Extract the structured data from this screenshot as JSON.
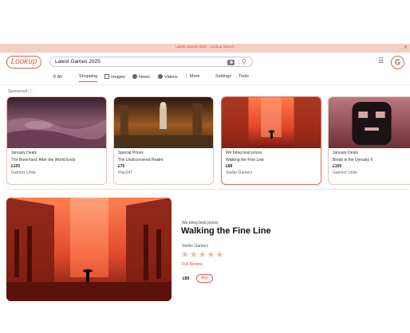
{
  "window": {
    "title": "Latest Games 2025 - Lookup Search",
    "new_tab_icon": "plus-icon"
  },
  "header": {
    "logo": "Lookup",
    "search_query": "Latest Games 2025",
    "avatar_letter": "G",
    "icons": [
      "camera-icon",
      "search-icon",
      "apps-grid-icon"
    ]
  },
  "tabs": [
    {
      "label": "All",
      "icon": "search-icon"
    },
    {
      "label": "Shopping",
      "active": true
    },
    {
      "label": "Images",
      "icon": "image-icon"
    },
    {
      "label": "News",
      "icon": "news-icon"
    },
    {
      "label": "Videos",
      "icon": "video-icon"
    },
    {
      "label": "More",
      "icon": "more-icon"
    },
    {
      "label": "Settings"
    },
    {
      "label": "Tools"
    }
  ],
  "sponsored": {
    "label": "Sponsored",
    "icon": "info-icon"
  },
  "products": [
    {
      "deal": "January Deals",
      "name": "The BoneYard: After the World Ends",
      "price": "£105",
      "seller": "Gamerz Unite"
    },
    {
      "deal": "Special Prices",
      "name": "The Undiscovered Realm",
      "price": "£75",
      "seller": "Play247"
    },
    {
      "deal": "We bring best prices",
      "name": "Walking the Fine Line",
      "price": "£89",
      "seller": "Steller Gamerz",
      "selected": true
    },
    {
      "deal": "January Deals",
      "name": "Break in the Dynasty II",
      "price": "£100",
      "seller": "Gamerz Unite"
    }
  ],
  "featured": {
    "deal": "We bring best prices",
    "title": "Walking the Fine Line",
    "seller": "Steller Gamerz",
    "rating_stars": "★★★★★",
    "rating": 0,
    "review_link": "Full Review",
    "price": "£89",
    "buy_label": "Buy"
  },
  "colors": {
    "accent": "#e05f49",
    "titlebar": "#f6cfc4",
    "card_border": "#e8c3b9"
  }
}
